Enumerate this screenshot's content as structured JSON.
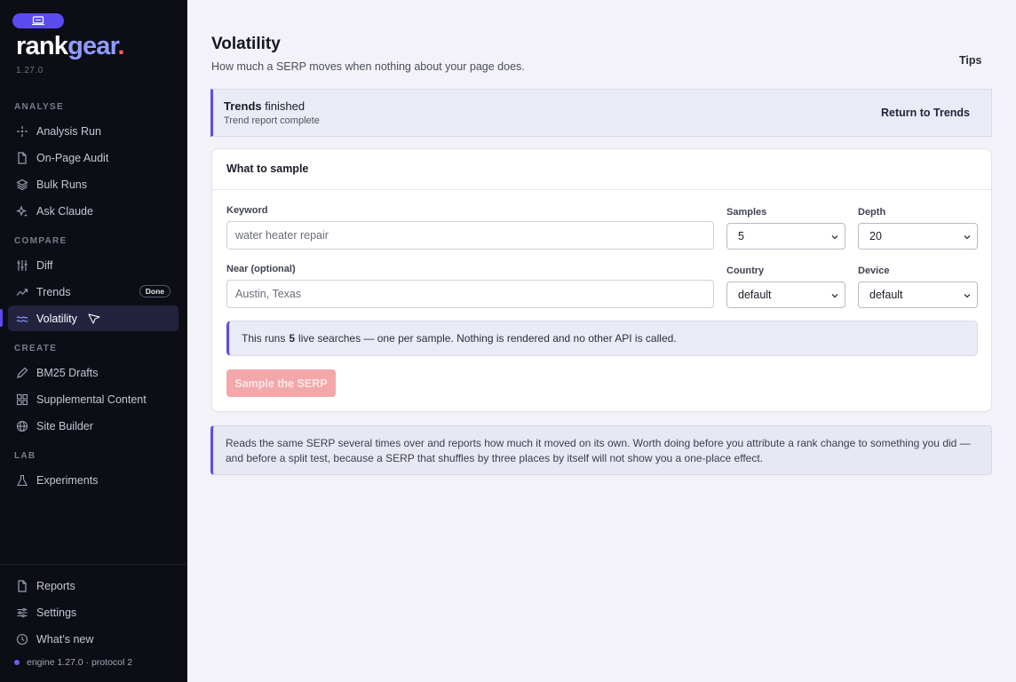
{
  "app": {
    "logo_part1": "rank",
    "logo_part2": "gear",
    "logo_part3": ".",
    "version": "1.27.0",
    "accent_color": "#5b4bf0"
  },
  "sidebar": {
    "sections": {
      "analyse": "ANALYSE",
      "compare": "COMPARE",
      "create": "CREATE",
      "lab": "LAB"
    },
    "items": {
      "analysis_run": "Analysis Run",
      "on_page_audit": "On-Page Audit",
      "bulk_runs": "Bulk Runs",
      "ask_claude": "Ask Claude",
      "diff": "Diff",
      "trends": "Trends",
      "trends_badge": "Done",
      "volatility": "Volatility",
      "bm25_drafts": "BM25 Drafts",
      "supplemental_content": "Supplemental Content",
      "site_builder": "Site Builder",
      "experiments": "Experiments",
      "reports": "Reports",
      "settings": "Settings",
      "whats_new": "What’s new"
    },
    "engine_status": "engine 1.27.0 · protocol 2"
  },
  "header": {
    "title": "Volatility",
    "subtitle": "How much a SERP moves when nothing about your page does.",
    "tips": "Tips"
  },
  "notice": {
    "title_bold": "Trends",
    "title_rest": " finished",
    "description": "Trend report complete",
    "action": "Return to Trends"
  },
  "form": {
    "heading": "What to sample",
    "keyword_label": "Keyword",
    "keyword_placeholder": "water heater repair",
    "near_label": "Near (optional)",
    "near_placeholder": "Austin, Texas",
    "samples_label": "Samples",
    "samples_value": "5",
    "depth_label": "Depth",
    "depth_value": "20",
    "country_label": "Country",
    "country_value": "default",
    "device_label": "Device",
    "device_value": "default",
    "info_before": "This runs",
    "info_count": "5",
    "info_after": "live searches — one per sample. Nothing is rendered and no other API is called.",
    "submit": "Sample the SERP"
  },
  "explanation": "Reads the same SERP several times over and reports how much it moved on its own. Worth doing before you attribute a rank change to something you did — and before a split test, because a SERP that shuffles by three places by itself will not show you a one-place effect."
}
